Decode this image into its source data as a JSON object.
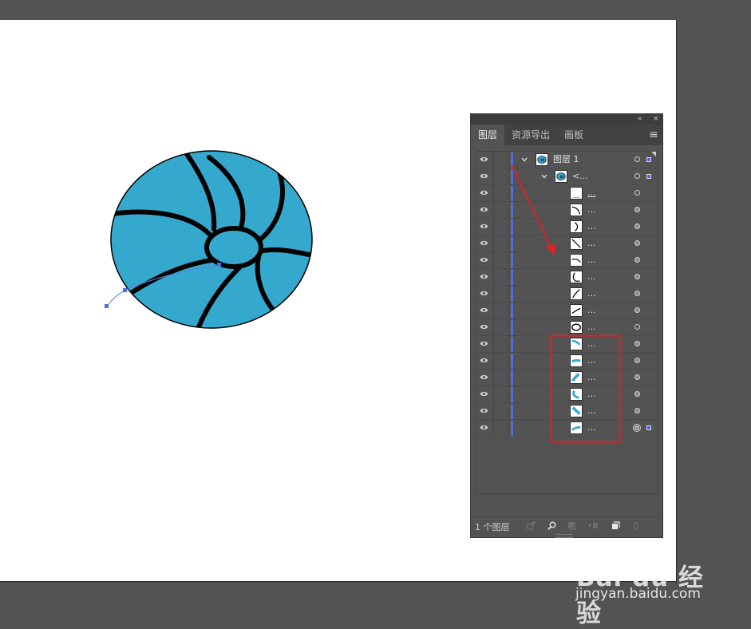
{
  "panel": {
    "collapse_icon": "«",
    "close_icon": "×",
    "tabs": [
      {
        "label": "图层",
        "active": true
      },
      {
        "label": "资源导出",
        "active": false
      },
      {
        "label": "画板",
        "active": false
      }
    ],
    "menu_icon": "≡",
    "rows": [
      {
        "label": "图层  1"
      },
      {
        "label": "<..."
      },
      {
        "label": "..."
      },
      {
        "label": "..."
      },
      {
        "label": "..."
      },
      {
        "label": "..."
      },
      {
        "label": "..."
      },
      {
        "label": "..."
      },
      {
        "label": "..."
      },
      {
        "label": "..."
      },
      {
        "label": "..."
      },
      {
        "label": "..."
      },
      {
        "label": "..."
      },
      {
        "label": "..."
      },
      {
        "label": "..."
      },
      {
        "label": "..."
      },
      {
        "label": "..."
      }
    ],
    "footer": {
      "layer_count": "1 个图层"
    }
  },
  "colors": {
    "fill": "#35a8cd",
    "stroke": "#000000",
    "annotation": "#e02020",
    "selection": "#4a6fe0"
  },
  "watermark": {
    "logo": "Bai du 经验",
    "url": "jingyan.baidu.com"
  }
}
